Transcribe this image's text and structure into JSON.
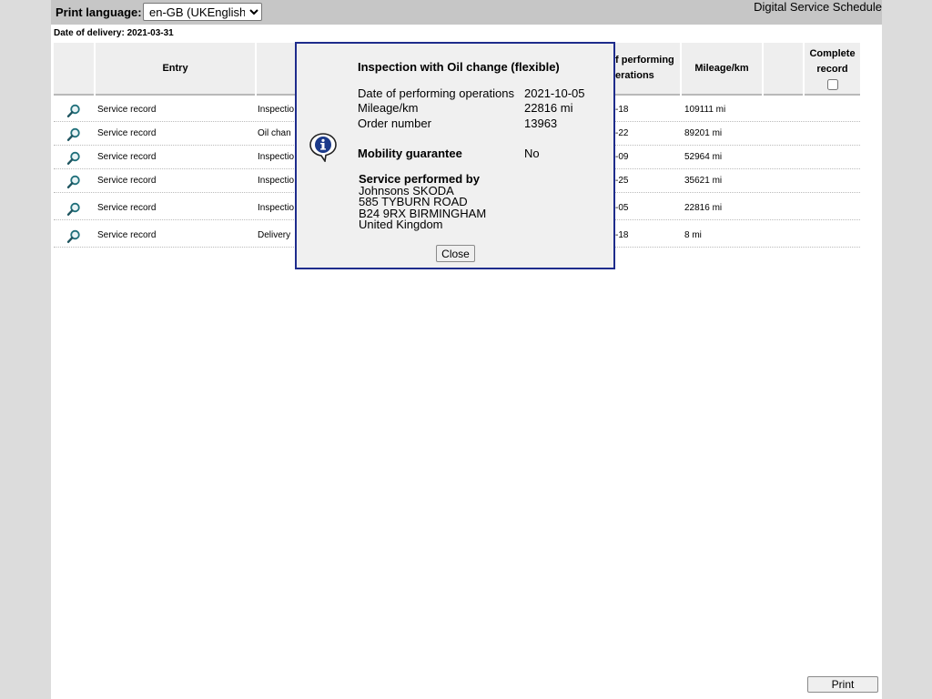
{
  "header": {
    "print_language_label": "Print language:",
    "print_language_value": "en-GB (UKEnglish)",
    "app_title": "Digital Service Schedule"
  },
  "date_of_delivery": "Date of delivery: 2021-03-31",
  "table": {
    "columns": {
      "entry": "Entry",
      "date_line1": "f performing",
      "date_line2": "erations",
      "mileage": "Mileage/km",
      "complete_line1": "Complete",
      "complete_line2": "record"
    },
    "rows": [
      {
        "entry": "Service record",
        "type": "Inspectio",
        "date": "-18",
        "mileage": "109111 mi"
      },
      {
        "entry": "Service record",
        "type": "Oil chan",
        "date": "-22",
        "mileage": "89201 mi"
      },
      {
        "entry": "Service record",
        "type": "Inspectio",
        "date": "-09",
        "mileage": "52964 mi"
      },
      {
        "entry": "Service record",
        "type": "Inspectio",
        "date": "-25",
        "mileage": "35621 mi"
      },
      {
        "entry": "Service record",
        "type": "Inspectio",
        "date": "-05",
        "mileage": "22816 mi"
      },
      {
        "entry": "Service record",
        "type": "Delivery",
        "date": "-18",
        "mileage": "8 mi"
      }
    ]
  },
  "print_button": "Print",
  "modal": {
    "title": "Inspection with Oil change (flexible)",
    "date_label": "Date of performing operations",
    "date_value": "2021-10-05",
    "mileage_label": "Mileage/km",
    "mileage_value": "22816 mi",
    "order_label": "Order number",
    "order_value": "13963",
    "mobility_label": "Mobility guarantee",
    "mobility_value": "No",
    "performed_by_label": "Service performed by",
    "address": [
      "Johnsons SKODA",
      "585 TYBURN ROAD",
      "B24 9RX BIRMINGHAM",
      "United Kingdom"
    ],
    "close_button": "Close"
  }
}
